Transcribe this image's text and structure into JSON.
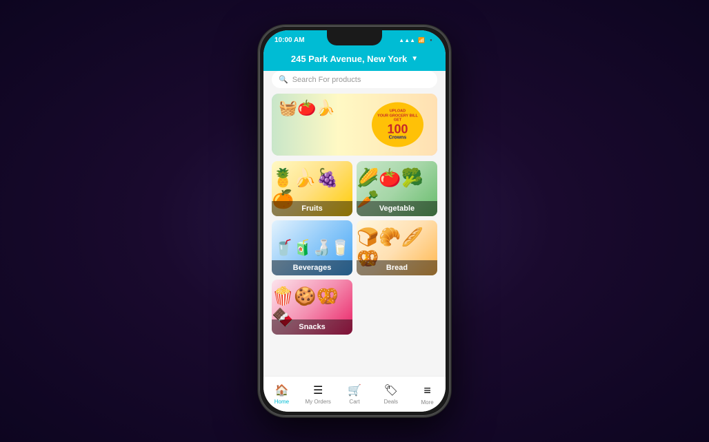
{
  "status_bar": {
    "time": "10:00 AM",
    "signal": "▲▲▲",
    "wifi": "WiFi",
    "battery": "🔋"
  },
  "header": {
    "address": "245 Park Avenue, New York",
    "chevron": "▼"
  },
  "search": {
    "placeholder": "Search For products",
    "icon": "🔍"
  },
  "banner": {
    "upload_line1": "UPLOAD",
    "upload_line2": "YOUR GROCERY BILL",
    "upload_line3": "GET",
    "amount": "100",
    "currency": "Crowns"
  },
  "categories": [
    {
      "id": "fruits",
      "label": "Fruits",
      "emoji": "🍍🍌🍇"
    },
    {
      "id": "vegetable",
      "label": "Vegetable",
      "emoji": "🌽🍅🥦"
    },
    {
      "id": "beverages",
      "label": "Beverages",
      "emoji": "🥤🍶🧃"
    },
    {
      "id": "bread",
      "label": "Bread",
      "emoji": "🍞🥐🥖"
    },
    {
      "id": "snacks",
      "label": "Snacks",
      "emoji": "🍿🍪🥨"
    }
  ],
  "nav": [
    {
      "id": "home",
      "label": "Home",
      "icon": "🏠",
      "active": true
    },
    {
      "id": "orders",
      "label": "My Orders",
      "icon": "☰",
      "active": false
    },
    {
      "id": "cart",
      "label": "Cart",
      "icon": "🛒",
      "active": false
    },
    {
      "id": "deals",
      "label": "Deals",
      "icon": "🏷",
      "active": false
    },
    {
      "id": "more",
      "label": "More",
      "icon": "≡",
      "active": false
    }
  ]
}
